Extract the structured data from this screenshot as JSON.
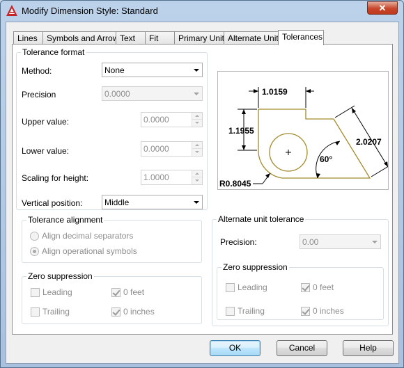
{
  "window": {
    "title": "Modify Dimension Style: Standard",
    "close_label": "✕"
  },
  "tabs": [
    "Lines",
    "Symbols and Arrows",
    "Text",
    "Fit",
    "Primary Units",
    "Alternate Units",
    "Tolerances"
  ],
  "active_tab": "Tolerances",
  "tolerance_format": {
    "legend": "Tolerance format",
    "method_label": "Method:",
    "method_value": "None",
    "precision_label": "Precision",
    "precision_value": "0.0000",
    "upper_label": "Upper value:",
    "upper_value": "0.0000",
    "lower_label": "Lower value:",
    "lower_value": "0.0000",
    "scaling_label": "Scaling for height:",
    "scaling_value": "1.0000",
    "vertical_label": "Vertical position:",
    "vertical_value": "Middle"
  },
  "tolerance_alignment": {
    "legend": "Tolerance alignment",
    "decimal_label": "Align decimal separators",
    "operational_label": "Align operational symbols",
    "selected": "operational"
  },
  "zero_suppression_primary": {
    "legend": "Zero suppression",
    "leading_label": "Leading",
    "leading_checked": false,
    "trailing_label": "Trailing",
    "trailing_checked": false,
    "feet_label": "0 feet",
    "feet_checked": true,
    "inches_label": "0 inches",
    "inches_checked": true
  },
  "alternate_unit_tolerance": {
    "legend": "Alternate unit tolerance",
    "precision_label": "Precision:",
    "precision_value": "0.00"
  },
  "zero_suppression_alternate": {
    "legend": "Zero suppression",
    "leading_label": "Leading",
    "leading_checked": false,
    "trailing_label": "Trailing",
    "trailing_checked": false,
    "feet_label": "0 feet",
    "feet_checked": true,
    "inches_label": "0 inches",
    "inches_checked": true
  },
  "preview": {
    "dim_top": "1.0159",
    "dim_left": "1.1955",
    "dim_right": "2.0207",
    "dim_angle": "60°",
    "dim_radius": "R0.8045",
    "shape_color": "#a08a2e"
  },
  "buttons": {
    "ok": "OK",
    "cancel": "Cancel",
    "help": "Help"
  }
}
